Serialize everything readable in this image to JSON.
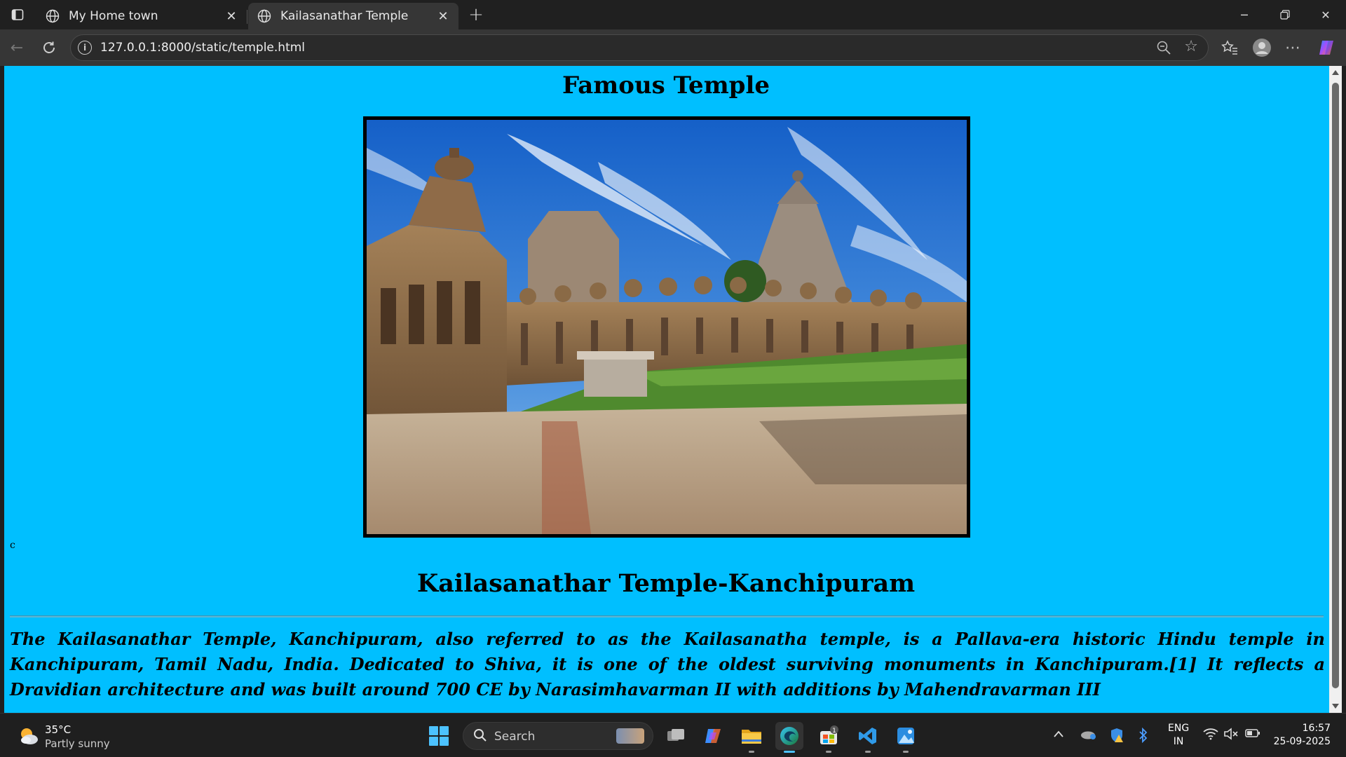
{
  "browser": {
    "tabs": [
      {
        "title": "My Home town",
        "active": false
      },
      {
        "title": "Kailasanathar Temple",
        "active": true
      }
    ],
    "url": "127.0.0.1:8000/static/temple.html"
  },
  "page": {
    "title": "Famous Temple",
    "image_alt": "Kailasanathar Temple, Kanchipuram",
    "stray_char": "c",
    "heading": "Kailasanathar Temple-Kanchipuram",
    "description": "The Kailasanathar Temple, Kanchipuram, also referred to as the Kailasanatha temple, is a Pallava-era historic Hindu temple in Kanchipuram, Tamil Nadu, India. Dedicated to Shiva, it is one of the oldest surviving monuments in Kanchipuram.[1] It reflects a Dravidian architecture and was built around 700 CE by Narasimhavarman II with additions by Mahendravarman III",
    "background_color": "#00bfff"
  },
  "taskbar": {
    "weather_temp": "35°C",
    "weather_desc": "Partly sunny",
    "search_label": "Search",
    "store_badge": "1",
    "lang_line1": "ENG",
    "lang_line2": "IN",
    "time": "16:57",
    "date": "25-09-2025"
  }
}
